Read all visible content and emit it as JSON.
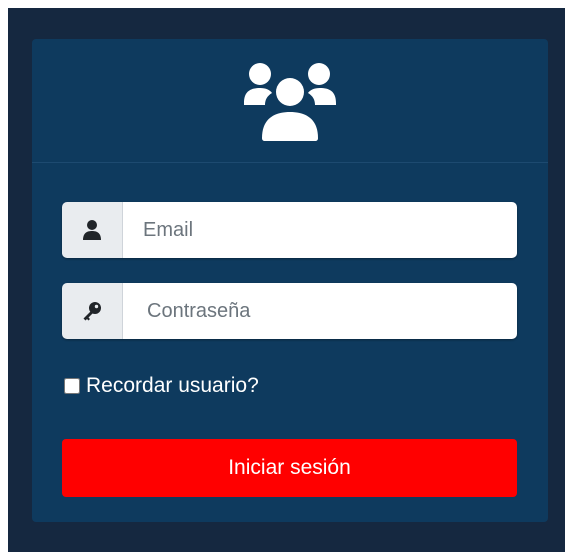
{
  "header": {
    "icon": "users-icon"
  },
  "form": {
    "email": {
      "icon": "user-icon",
      "placeholder": "Email",
      "value": ""
    },
    "password": {
      "icon": "key-icon",
      "placeholder": "Contraseña",
      "value": ""
    },
    "remember": {
      "label": "Recordar usuario?",
      "checked": false
    },
    "submit_label": "Iniciar sesión"
  },
  "colors": {
    "background": "#152840",
    "card": "#0e3a5e",
    "button": "#ff0000",
    "addon": "#e9ecef"
  }
}
